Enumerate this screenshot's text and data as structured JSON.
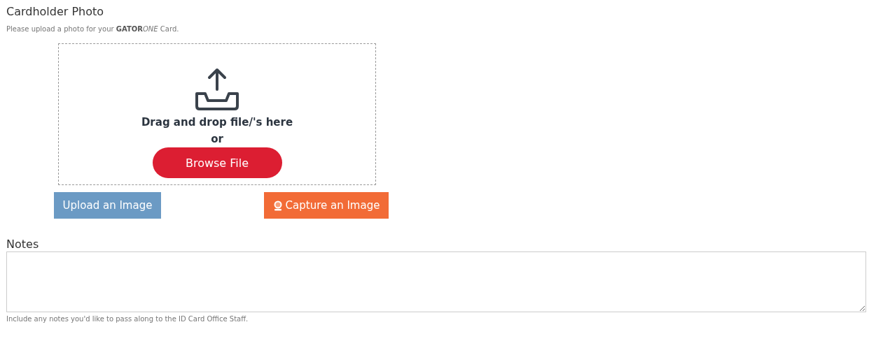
{
  "photo_section": {
    "title": "Cardholder Photo",
    "description": {
      "before": "Please upload a photo for your ",
      "bold": "GATOR",
      "italic": "ONE",
      "after": " Card."
    },
    "dropzone": {
      "prompt": "Drag and drop file/'s here",
      "separator": "or",
      "browse_button": "Browse File"
    },
    "buttons": [
      {
        "kind": "upload",
        "label": "Upload an Image"
      },
      {
        "kind": "capture",
        "label": "Capture an Image"
      }
    ]
  },
  "notes": {
    "label": "Notes",
    "help": "Include any notes you'd like to pass along to the ID Card Office Staff."
  }
}
